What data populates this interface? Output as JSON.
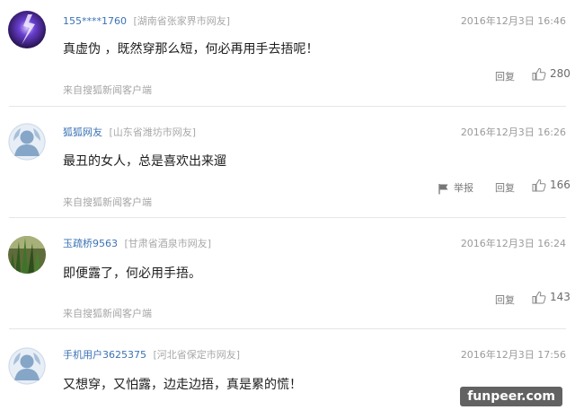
{
  "comments": [
    {
      "username": "155****1760",
      "location": "[湖南省张家界市网友]",
      "timestamp": "2016年12月3日 16:46",
      "text": "真虚伪 ，既然穿那么短，何必再用手去捂呢！",
      "reply_label": "回复",
      "likes": "280",
      "source": "来自搜狐新闻客户端",
      "avatar_icon": "purple-lightning-avatar"
    },
    {
      "username": "狐狐网友",
      "location": "[山东省潍坊市网友]",
      "timestamp": "2016年12月3日 16:26",
      "text": "最丑的女人，总是喜欢出来遛",
      "report_label": "举报",
      "reply_label": "回复",
      "likes": "166",
      "source": "来自搜狐新闻客户端",
      "avatar_icon": "default-user-avatar"
    },
    {
      "username": "玉疏桥9563",
      "location": "[甘肃省酒泉市网友]",
      "timestamp": "2016年12月3日 16:24",
      "text": "即便露了，何必用手捂。",
      "reply_label": "回复",
      "likes": "143",
      "source": "来自搜狐新闻客户端",
      "avatar_icon": "green-plant-avatar"
    },
    {
      "username": "手机用户3625375",
      "location": "[河北省保定市网友]",
      "timestamp": "2016年12月3日 17:56",
      "text": "又想穿，又怕露，边走边捂，真是累的慌！",
      "avatar_icon": "default-user-avatar"
    }
  ],
  "watermark": "funpeer.com",
  "colors": {
    "username": "#3a72b5",
    "location": "#a8a8a8",
    "meta": "#9a9a9a"
  }
}
